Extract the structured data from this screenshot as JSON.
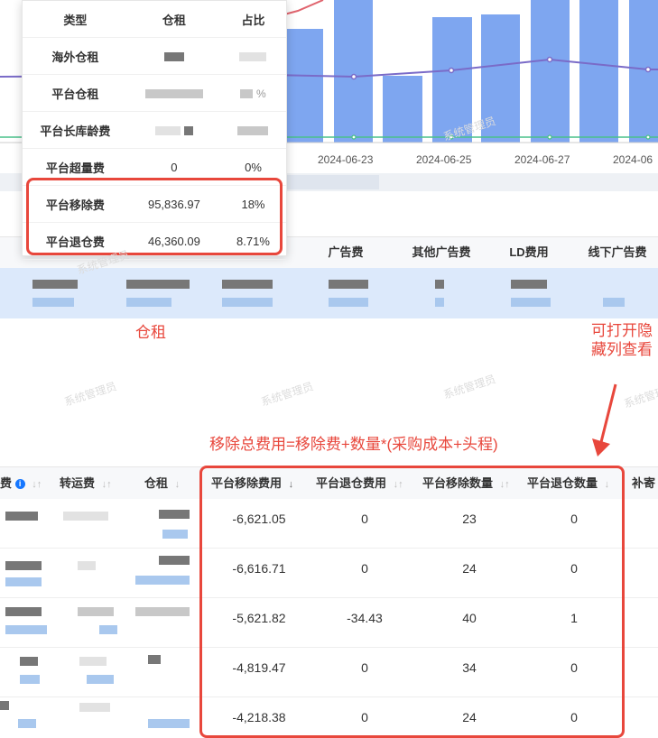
{
  "chart": {
    "x_ticks": [
      "2024-06-23",
      "2024-06-25",
      "2024-06-27",
      "2024-06"
    ]
  },
  "tooltip": {
    "headers": [
      "类型",
      "仓租",
      "占比"
    ],
    "rows": [
      {
        "type": "海外仓租",
        "rent": "",
        "ratio": ""
      },
      {
        "type": "平台仓租",
        "rent": "",
        "ratio": "%"
      },
      {
        "type": "平台长库龄费",
        "rent": "",
        "ratio": ""
      },
      {
        "type": "平台超量费",
        "rent": "0",
        "ratio": "0%"
      },
      {
        "type": "平台移除费",
        "rent": "95,836.97",
        "ratio": "18%"
      },
      {
        "type": "平台退仓费",
        "rent": "46,360.09",
        "ratio": "8.71%"
      }
    ]
  },
  "mid_header": {
    "cols": [
      "广告费",
      "其他广告费",
      "LD费用",
      "线下广告费"
    ]
  },
  "annotations": {
    "warehouse": "仓租",
    "hidden_columns": "可打开隐藏列查看",
    "formula": "移除总费用=移除费+数量*(采购成本+头程)"
  },
  "watermark": "系统管理员",
  "table": {
    "headers": {
      "fee": "费",
      "transfer": "转运费",
      "rent": "仓租",
      "removal_fee": "平台移除费用",
      "return_fee": "平台退仓费用",
      "removal_qty": "平台移除数量",
      "return_qty": "平台退仓数量",
      "supplement": "补寄"
    },
    "rows": [
      {
        "removal_fee": "-6,621.05",
        "return_fee": "0",
        "removal_qty": "23",
        "return_qty": "0"
      },
      {
        "removal_fee": "-6,616.71",
        "return_fee": "0",
        "removal_qty": "24",
        "return_qty": "0"
      },
      {
        "removal_fee": "-5,621.82",
        "return_fee": "-34.43",
        "removal_qty": "40",
        "return_qty": "1"
      },
      {
        "removal_fee": "-4,819.47",
        "return_fee": "0",
        "removal_qty": "34",
        "return_qty": "0"
      },
      {
        "removal_fee": "-4,218.38",
        "return_fee": "0",
        "removal_qty": "24",
        "return_qty": "0"
      }
    ]
  },
  "colors": {
    "highlight": "#e8473c",
    "bar": "#7ea6f0",
    "line_purple": "#7a6bc8",
    "line_green": "#48c08a",
    "line_red": "#e0646e",
    "row_highlight": "#dce9fb"
  }
}
